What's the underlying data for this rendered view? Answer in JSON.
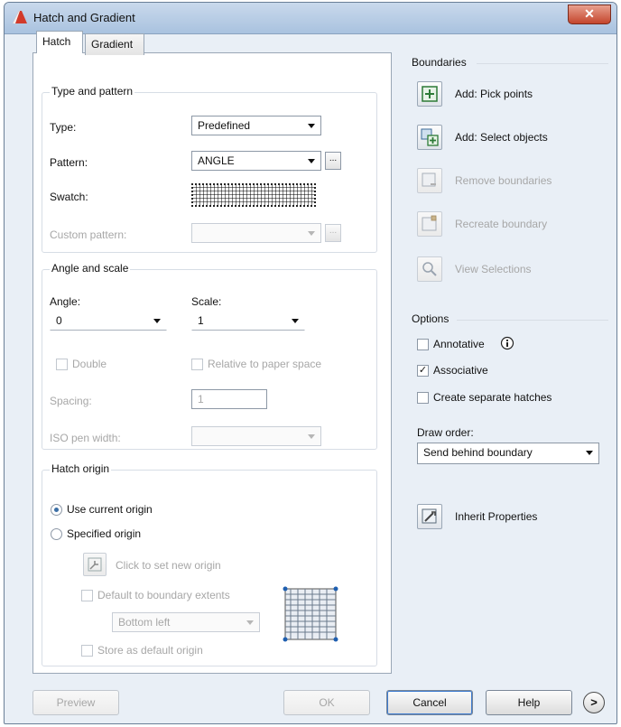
{
  "window": {
    "title": "Hatch and Gradient",
    "close": "✕"
  },
  "tabs": [
    {
      "label": "Hatch",
      "active": true
    },
    {
      "label": "Gradient",
      "active": false
    }
  ],
  "type_and_pattern": {
    "group_title": "Type and pattern",
    "type_label": "Type:",
    "type_value": "Predefined",
    "pattern_label": "Pattern:",
    "pattern_value": "ANGLE",
    "pattern_browse": "...",
    "swatch_label": "Swatch:",
    "custom_label": "Custom pattern:",
    "custom_browse": "..."
  },
  "angle_scale": {
    "group_title": "Angle and scale",
    "angle_label": "Angle:",
    "angle_value": "0",
    "scale_label": "Scale:",
    "scale_value": "1",
    "double_label": "Double",
    "relative_label": "Relative to paper space",
    "spacing_label": "Spacing:",
    "spacing_value": "1",
    "iso_label": "ISO pen width:"
  },
  "hatch_origin": {
    "group_title": "Hatch origin",
    "use_current_label": "Use current origin",
    "specified_label": "Specified origin",
    "click_set_label": "Click to set new origin",
    "default_extents_label": "Default to boundary extents",
    "position_value": "Bottom left",
    "store_default_label": "Store as default origin"
  },
  "boundaries": {
    "title": "Boundaries",
    "add_pick": "Add: Pick points",
    "add_select": "Add: Select objects",
    "remove": "Remove boundaries",
    "recreate": "Recreate boundary",
    "view": "View Selections"
  },
  "options": {
    "title": "Options",
    "annotative": "Annotative",
    "associative": "Associative",
    "associative_checked": true,
    "separate": "Create separate hatches",
    "draw_order_label": "Draw order:",
    "draw_order_value": "Send behind boundary"
  },
  "inherit": {
    "label": "Inherit Properties"
  },
  "footer": {
    "preview": "Preview",
    "ok": "OK",
    "cancel": "Cancel",
    "help": "Help",
    "more": ">"
  },
  "colors": {
    "accent": "#3a6ea5",
    "titlebar": "#b9cde5",
    "close": "#c4452c"
  }
}
